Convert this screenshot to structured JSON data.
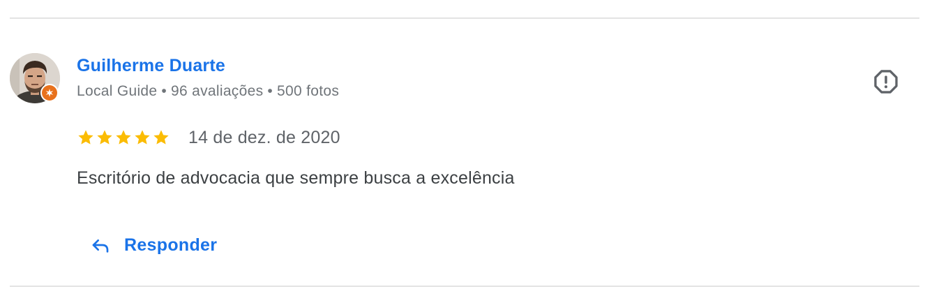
{
  "review": {
    "reviewer": {
      "name": "Guilherme Duarte",
      "level": "Local Guide",
      "reviews_count": "96 avaliações",
      "photos_count": "500 fotos",
      "separator": "•",
      "badge_icon": "local-guide-star-icon",
      "badge_color": "#e8711c"
    },
    "rating": {
      "stars": 5,
      "max_stars": 5,
      "star_color": "#fbbc04"
    },
    "date": "14 de dez. de 2020",
    "text": "Escritório de advocacia que sempre busca a excelência",
    "actions": {
      "reply_label": "Responder",
      "reply_icon": "reply-arrow-icon",
      "flag_icon": "report-exclamation-icon"
    }
  },
  "colors": {
    "link_blue": "#1a73e8",
    "meta_gray": "#70757a",
    "text_dark": "#3c4043",
    "divider": "#e3e3e3"
  }
}
